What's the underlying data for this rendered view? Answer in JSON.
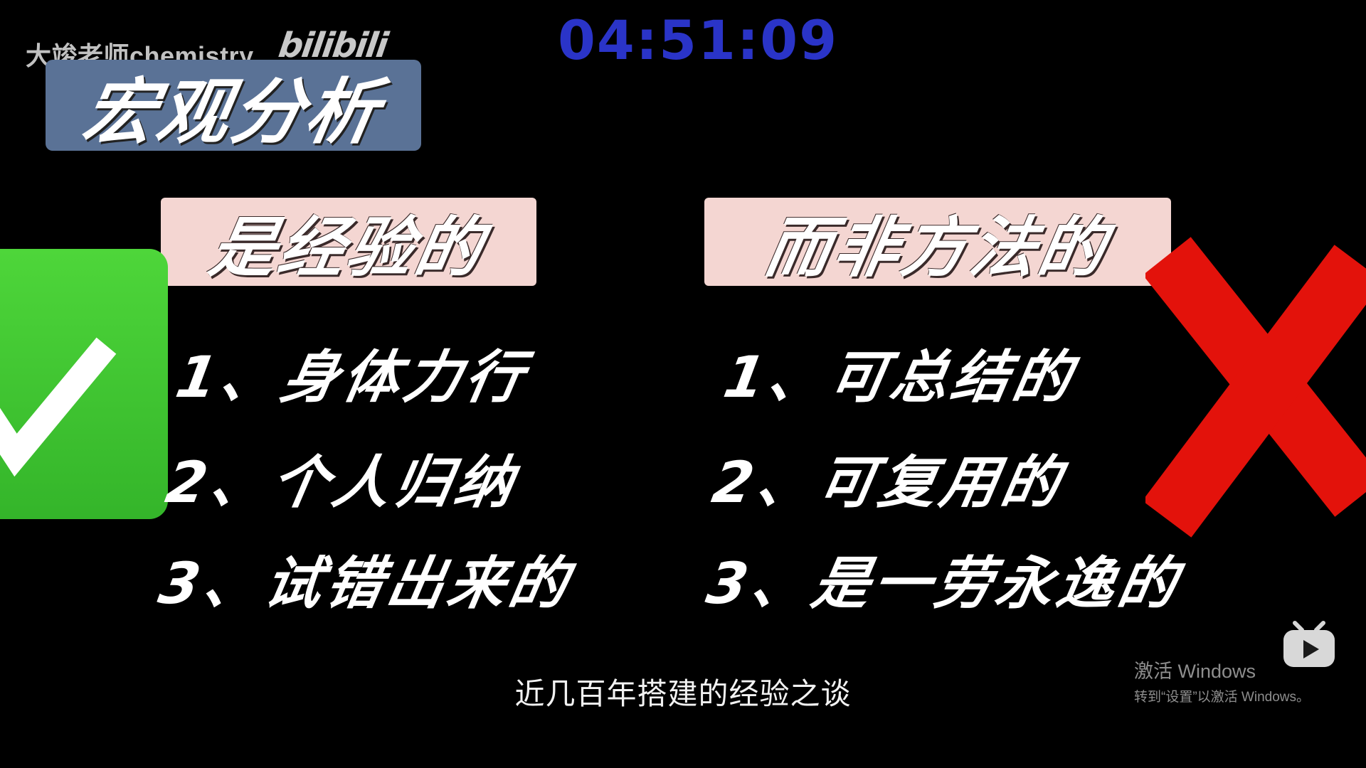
{
  "watermark": {
    "channel": "大竣老师chemistry",
    "logo": "bilibili"
  },
  "timer": "04:51:09",
  "badge": {
    "title": "宏观分析"
  },
  "left": {
    "tag": "是经验的",
    "items": [
      "1、身体力行",
      "2、个人归纳",
      "3、试错出来的"
    ],
    "icon": "checkmark-icon",
    "color": "#3cc22e"
  },
  "right": {
    "tag": "而非方法的",
    "items": [
      "1、可总结的",
      "2、可复用的",
      "3、是一劳永逸的"
    ],
    "icon": "cross-icon",
    "color": "#e3120b"
  },
  "subtitle": "近几百年搭建的经验之谈",
  "windows_activation": {
    "title": "激活 Windows",
    "subtitle": "转到“设置”以激活 Windows。"
  },
  "player": {
    "icon": "bilibili-play-icon"
  }
}
